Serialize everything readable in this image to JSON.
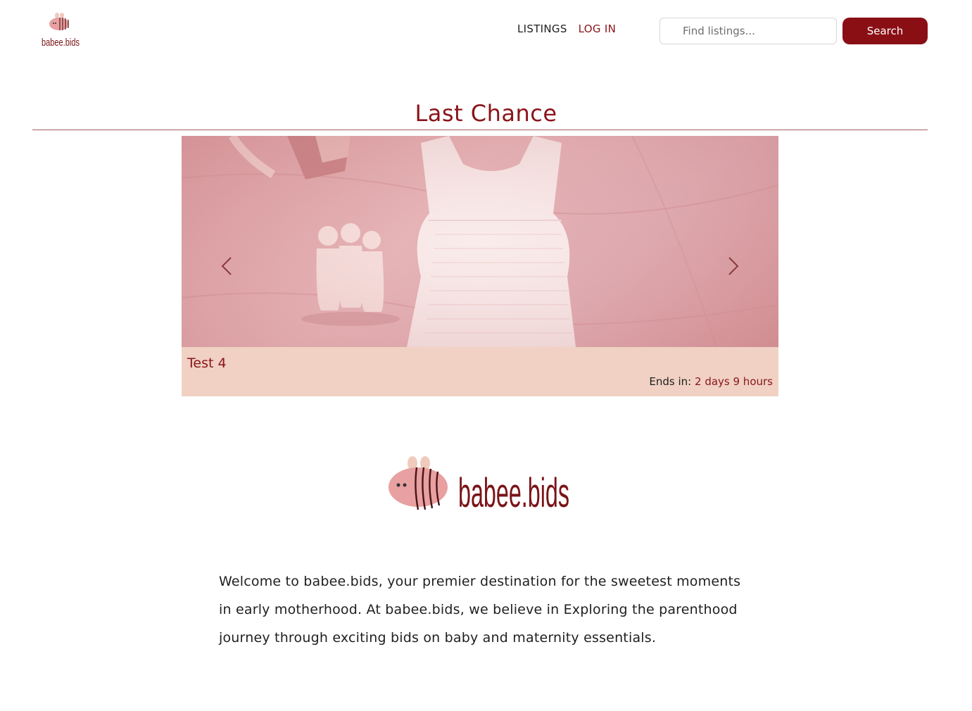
{
  "header": {
    "logo": {
      "brand_text": "babee.bids",
      "icon": "bee-icon"
    },
    "nav": {
      "listings_label": "LISTINGS",
      "login_label": "LOG IN"
    },
    "search": {
      "placeholder": "Find listings...",
      "value": "",
      "button_label": "Search"
    }
  },
  "main": {
    "section_title": "Last Chance",
    "carousel": {
      "item_title": "Test 4",
      "ends_label": "Ends in:",
      "ends_value": "2 days 9 hours",
      "prev_icon": "chevron-left-icon",
      "next_icon": "chevron-right-icon"
    },
    "brand_logo": {
      "brand_text": "babee.bids",
      "icon": "bee-icon"
    },
    "welcome_text": "Welcome to babee.bids, your premier destination for the sweetest moments in early motherhood. At babee.bids, we believe in Exploring the parenthood journey through exciting bids on baby and maternity essentials."
  },
  "colors": {
    "brand": "#8a0f15",
    "accent_text": "#8a1419",
    "caption_bg": "#f0d1c3",
    "bee_body": "#e8a0a0"
  }
}
